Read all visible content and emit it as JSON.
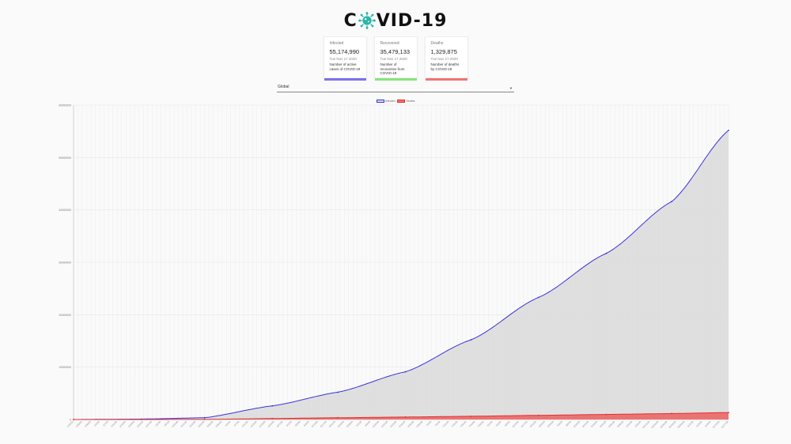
{
  "app": {
    "title_left": "C",
    "title_right": "VID-19"
  },
  "icons": {
    "virus": "virus-icon",
    "dropdown": "caret-down-icon"
  },
  "colors": {
    "infected": "#3b32e0",
    "recovered": "#86e57b",
    "deaths": "#e03030",
    "area": "#dcdcdc"
  },
  "cards": [
    {
      "key": "infected",
      "title": "Infected",
      "value": "55,174,990",
      "date": "Tue Nov 17 2020",
      "desc": "Number of active cases of COVID-19"
    },
    {
      "key": "recovered",
      "title": "Recovered",
      "value": "35,479,133",
      "date": "Tue Nov 17 2020",
      "desc": "Number of recoveries from COVID-19"
    },
    {
      "key": "deaths",
      "title": "Deaths",
      "value": "1,329,875",
      "date": "Tue Nov 17 2020",
      "desc": "Number of deaths by COVID-19"
    }
  ],
  "country_select": {
    "value": "Global"
  },
  "chart_data": {
    "type": "line",
    "legend": [
      "Infected",
      "Deaths"
    ],
    "legend_position": "top-center",
    "grid": true,
    "ylim": [
      0,
      60000000
    ],
    "y_ticks": [
      "0",
      "10000000",
      "20000000",
      "30000000",
      "40000000",
      "50000000",
      "60000000"
    ],
    "x_range": [
      "2020-01-22",
      "2020-11-17"
    ],
    "series": [
      {
        "name": "Infected",
        "x": [
          "2020-01-22",
          "2020-02-22",
          "2020-03-22",
          "2020-04-22",
          "2020-05-22",
          "2020-06-22",
          "2020-07-22",
          "2020-08-22",
          "2020-09-22",
          "2020-10-22",
          "2020-11-17"
        ],
        "values": [
          555,
          78000,
          340000,
          2600000,
          5200000,
          9100000,
          15200000,
          23300000,
          31700000,
          41600000,
          55174990
        ]
      },
      {
        "name": "Deaths",
        "x": [
          "2020-01-22",
          "2020-02-22",
          "2020-03-22",
          "2020-04-22",
          "2020-05-22",
          "2020-06-22",
          "2020-07-22",
          "2020-08-22",
          "2020-09-22",
          "2020-10-22",
          "2020-11-17"
        ],
        "values": [
          17,
          2400,
          14600,
          184000,
          340000,
          470000,
          620000,
          800000,
          970000,
          1140000,
          1329875
        ]
      }
    ]
  }
}
